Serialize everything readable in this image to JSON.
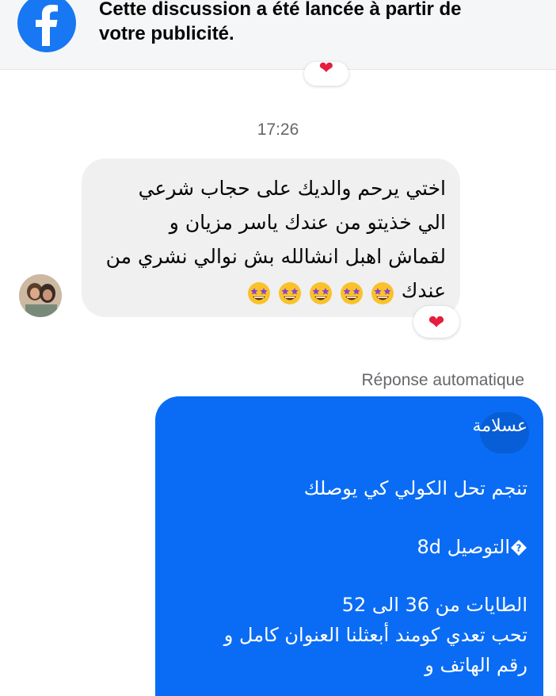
{
  "banner": {
    "icon": "facebook-icon",
    "text_line1": "Cette discussion a été lancée à partir de",
    "text_line2": "votre publicité."
  },
  "thread": {
    "timestamp": "17:26",
    "incoming_message": {
      "line1": "اختي يرحم والديك على حجاب شرعي",
      "line2": "الي خذيتو من عندك ياسر مزيان و",
      "line3": "لقماش اهبل انشالله بش نوالي نشري من",
      "line4": "عندك",
      "emoji": "star-struck-emoji",
      "emoji_count": 5
    },
    "reaction": "❤",
    "pinned_reaction": "❤",
    "auto_reply_label": "Réponse automatique",
    "outgoing_message": {
      "line1": "عسلامة",
      "line2": "تنجم تحل الكولي كي يوصلك",
      "line3_text": "التوصيل 8d",
      "line3_icon": "diamond-question-icon",
      "line4": "الطايات من 36  الى 52",
      "line5": "تحب تعدي كومند أبعثلنا العنوان كامل و",
      "line6": "رقم الهاتف و"
    }
  },
  "colors": {
    "facebook_blue": "#1877f2",
    "outgoing_bubble": "#0a6cf4",
    "incoming_bubble": "#f0f0f0",
    "heart": "#e41e3f",
    "secondary_text": "#65676b"
  }
}
